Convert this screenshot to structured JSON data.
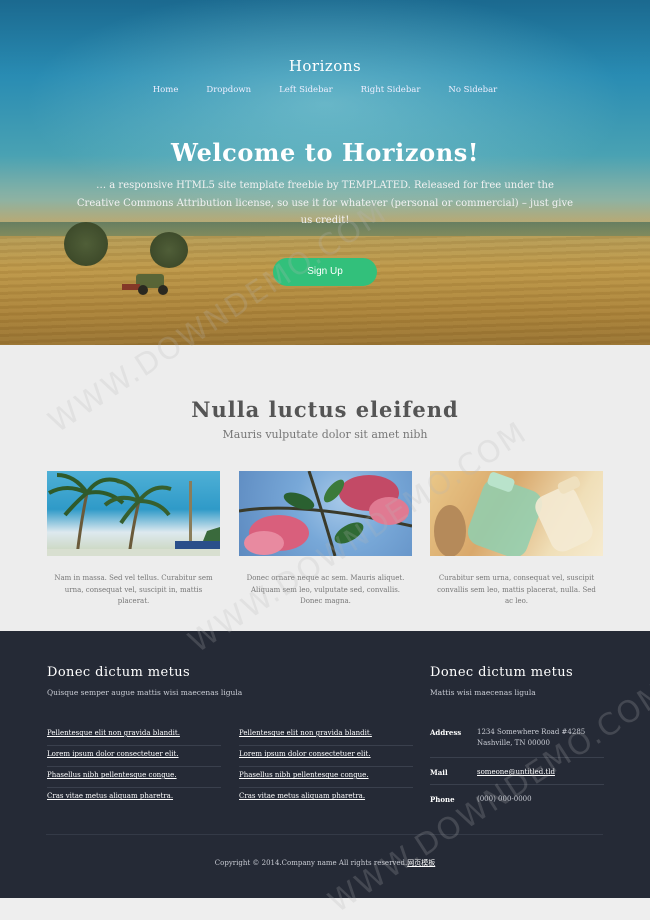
{
  "site": {
    "title": "Horizons"
  },
  "nav": [
    {
      "label": "Home"
    },
    {
      "label": "Dropdown"
    },
    {
      "label": "Left Sidebar"
    },
    {
      "label": "Right Sidebar"
    },
    {
      "label": "No Sidebar"
    }
  ],
  "hero": {
    "title": "Welcome to Horizons!",
    "text": "… a responsive HTML5 site template freebie by TEMPLATED. Released for free under the Creative Commons Attribution license, so use it for whatever (personal or commercial) – just give us credit!",
    "button_label": "Sign Up"
  },
  "features": {
    "title": "Nulla luctus eleifend",
    "subtitle": "Mauris vulputate dolor sit amet nibh",
    "cards": [
      {
        "image": "palm-trees-photo",
        "text": "Nam in massa. Sed vel tellus. Curabitur sem urna, consequat vel, suscipit in, mattis placerat."
      },
      {
        "image": "pink-flowers-photo",
        "text": "Donec ornare neque ac sem. Mauris aliquet. Aliquam sem leo, vulputate sed, convallis. Donec magna."
      },
      {
        "image": "glass-jars-photo",
        "text": "Curabitur sem urna, consequat vel, suscipit convallis sem leo, mattis placerat, nulla. Sed ac leo."
      }
    ]
  },
  "footer": {
    "left_title": "Donec dictum metus",
    "left_subtitle": "Quisque semper augue mattis wisi maecenas ligula",
    "links_col1": [
      "Pellentesque elit non gravida blandit.",
      "Lorem ipsum dolor consectetuer elit.",
      "Phasellus nibh pellentesque congue.",
      "Cras vitae metus aliquam pharetra."
    ],
    "links_col2": [
      "Pellentesque elit non gravida blandit.",
      "Lorem ipsum dolor consectetuer elit.",
      "Phasellus nibh pellentesque congue.",
      "Cras vitae metus aliquam pharetra."
    ],
    "right_title": "Donec dictum metus",
    "right_subtitle": "Mattis wisi maecenas ligula",
    "contact": {
      "address_label": "Address",
      "address_line1": "1234 Somewhere Road #4285",
      "address_line2": "Nashville, TN 00000",
      "mail_label": "Mail",
      "mail_value": "someone@untitled.tld",
      "phone_label": "Phone",
      "phone_value": "(000) 000-0000"
    },
    "copyright": "Copyright © 2014.Company name All rights reserved.",
    "copyright_link": "网页模板"
  },
  "watermark": "WWW.DOWNDEMO.COM",
  "colors": {
    "accent": "#32c07b",
    "footer_bg": "#252a36",
    "section_bg": "#ededed"
  }
}
